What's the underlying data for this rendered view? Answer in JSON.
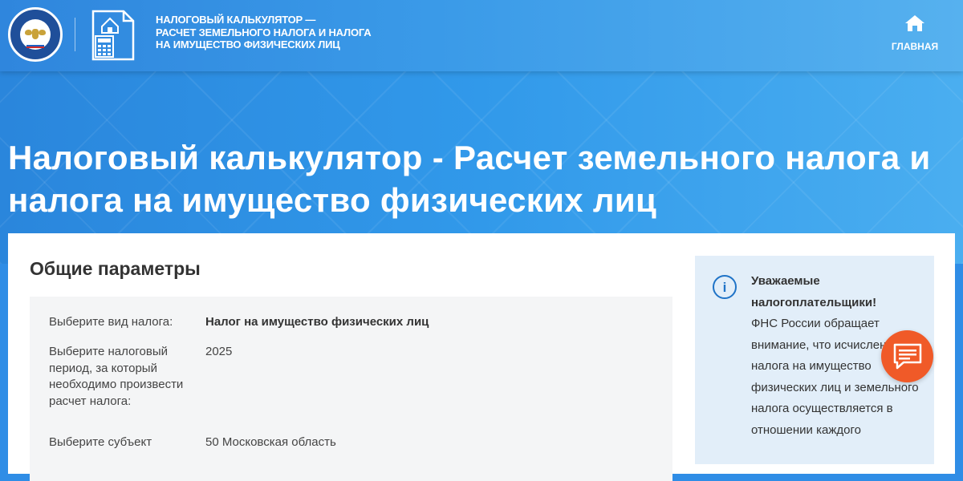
{
  "header": {
    "title_line1": "НАЛОГОВЫЙ КАЛЬКУЛЯТОР —",
    "title_line2": "РАСЧЕТ ЗЕМЕЛЬНОГО НАЛОГА И НАЛОГА",
    "title_line3": "НА ИМУЩЕСТВО ФИЗИЧЕСКИХ ЛИЦ",
    "home_label": "ГЛАВНАЯ",
    "emblem_icon": "fns-emblem-icon",
    "calculator_icon": "tax-calculator-logo-icon"
  },
  "hero": {
    "title": "Налоговый калькулятор - Расчет земельного налога и налога на имущество физических лиц"
  },
  "params": {
    "section_title": "Общие параметры",
    "tax_type": {
      "label": "Выберите вид налога:",
      "value": "Налог на имущество физических лиц"
    },
    "period": {
      "label": "Выберите налоговый период, за который необходимо произвести расчет налога:",
      "value": "2025"
    },
    "region": {
      "label": "Выберите субъект",
      "value": "50 Московская область"
    }
  },
  "info": {
    "heading": "Уважаемые налогоплательщики!",
    "body": "ФНС России обращает внимание, что исчисление налога на имущество физических лиц и земельного налога осуществляется в отношении каждого"
  },
  "colors": {
    "header_blue": "#2f86dd",
    "hero_blue": "#2e93e8",
    "panel_gray": "#f4f5f6",
    "info_blue": "#e2eef9",
    "accent_orange": "#f05a28",
    "icon_blue": "#1f73c7"
  }
}
